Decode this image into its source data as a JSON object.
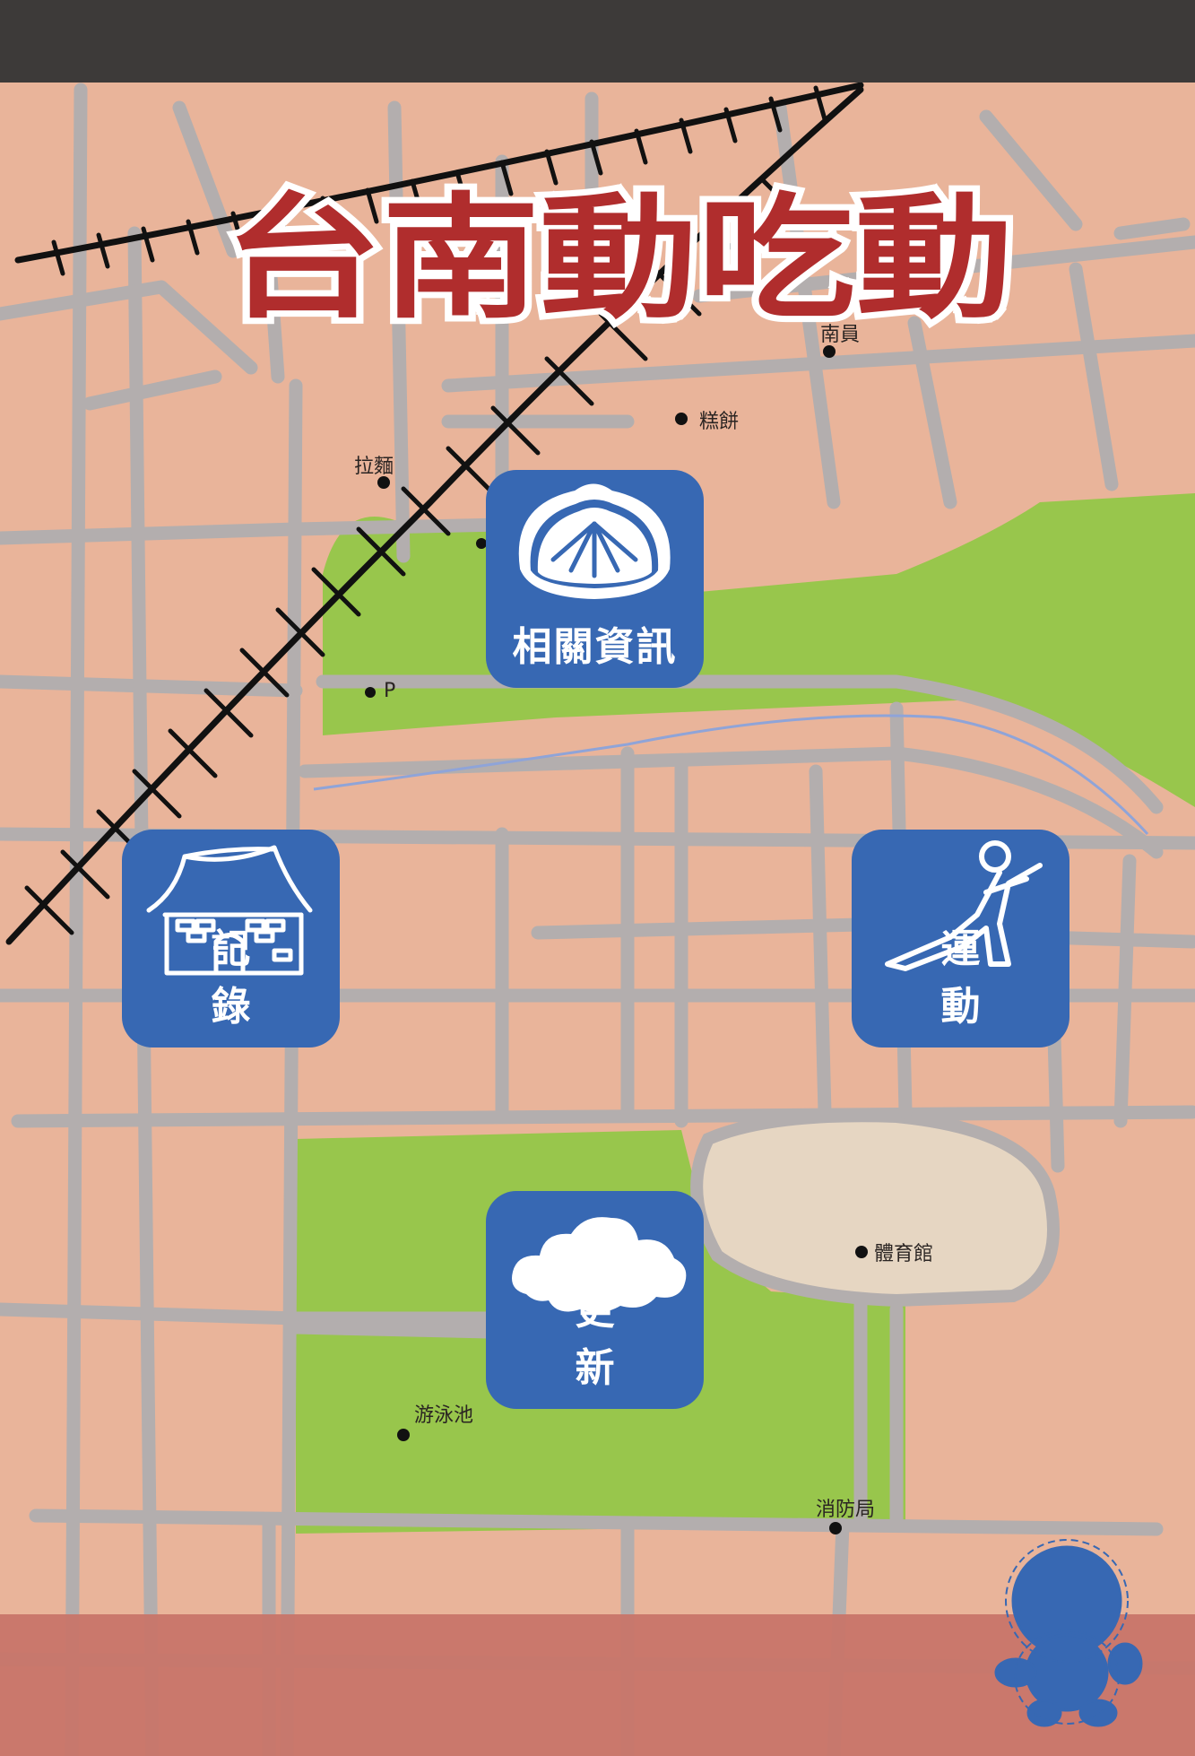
{
  "app": {
    "title": "台南動吃動"
  },
  "menu": {
    "info": {
      "label": "相關資訊",
      "icon": "bun-icon"
    },
    "record": {
      "label": "記錄",
      "icon": "temple-icon"
    },
    "exercise": {
      "label": "運動",
      "icon": "runner-icon"
    },
    "update": {
      "label": "更新",
      "icon": "cloud-icon"
    }
  },
  "map": {
    "landmarks": {
      "l1": "糕餅",
      "l2": "拉麵",
      "l3": "P",
      "l4": "南員",
      "l5": "體育館",
      "l6": "游泳池",
      "l7": "消防局"
    }
  },
  "colors": {
    "status_bar": "#3d3a39",
    "map_background": "#e9b49a",
    "road": "#b3aeae",
    "park": "#98c64c",
    "stadium": "#e6d6c2",
    "tile": "#3768b3",
    "title_fill": "#b02d2d",
    "footer": "#c8766a"
  }
}
